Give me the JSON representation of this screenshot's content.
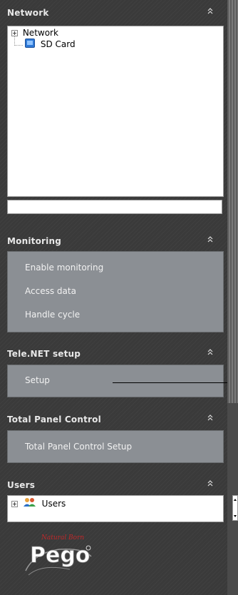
{
  "network": {
    "title": "Network",
    "tree": [
      {
        "label": "Network"
      },
      {
        "label": "SD Card"
      }
    ],
    "input_value": ""
  },
  "monitoring": {
    "title": "Monitoring",
    "items": [
      "Enable monitoring",
      "Access data",
      "Handle cycle"
    ]
  },
  "telenet": {
    "title": "Tele.NET setup",
    "items": [
      "Setup"
    ]
  },
  "tpc": {
    "title": "Total Panel Control",
    "items": [
      "Total Panel Control Setup"
    ]
  },
  "users": {
    "title": "Users",
    "tree": [
      {
        "label": "Users"
      }
    ]
  },
  "logo": {
    "brand": "Pego",
    "tagline": "Natural Born"
  },
  "colors": {
    "menu_bg": "#8b8f94",
    "sidebar_bg": "#3a3a3a",
    "logo_red": "#c0282a"
  }
}
